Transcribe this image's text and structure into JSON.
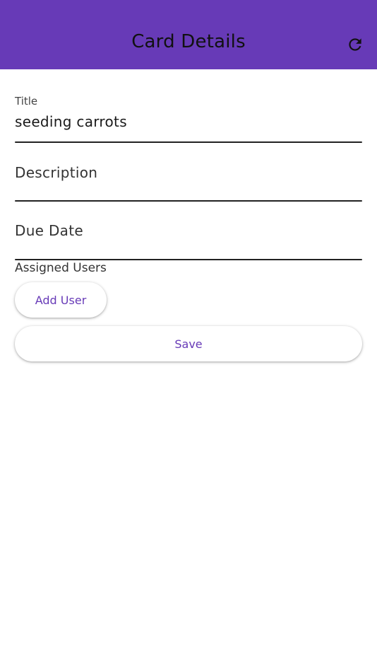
{
  "app_bar": {
    "title": "Card Details",
    "background_color": "#673ab7",
    "refresh_icon": "refresh-icon"
  },
  "form": {
    "title": {
      "label": "Title",
      "value": "seeding carrots"
    },
    "description": {
      "label": "Description",
      "value": ""
    },
    "due_date": {
      "label": "Due Date",
      "value": ""
    },
    "assigned_users": {
      "label": "Assigned Users",
      "add_button_label": "Add User"
    },
    "save_button_label": "Save"
  },
  "colors": {
    "accent": "#673ab7",
    "underline": "#222222"
  }
}
